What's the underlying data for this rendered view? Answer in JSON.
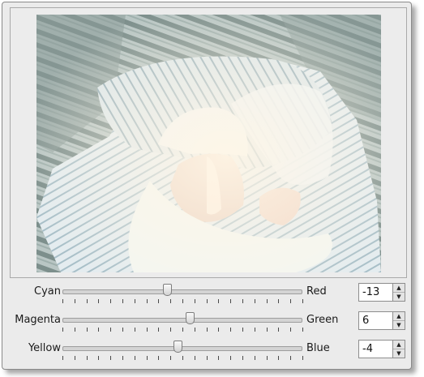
{
  "preview": {
    "image_alt": "Photo preview of a newborn baby wrapped in striped blankets"
  },
  "sliders": [
    {
      "left_label": "Cyan",
      "right_label": "Red",
      "value": "-13",
      "level": -13
    },
    {
      "left_label": "Magenta",
      "right_label": "Green",
      "value": "6",
      "level": 6
    },
    {
      "left_label": "Yellow",
      "right_label": "Blue",
      "value": "-4",
      "level": -4
    }
  ],
  "range": {
    "min": -100,
    "max": 100
  },
  "icons": {
    "spin_up": "spin-up-arrow-icon",
    "spin_down": "spin-down-arrow-icon"
  }
}
